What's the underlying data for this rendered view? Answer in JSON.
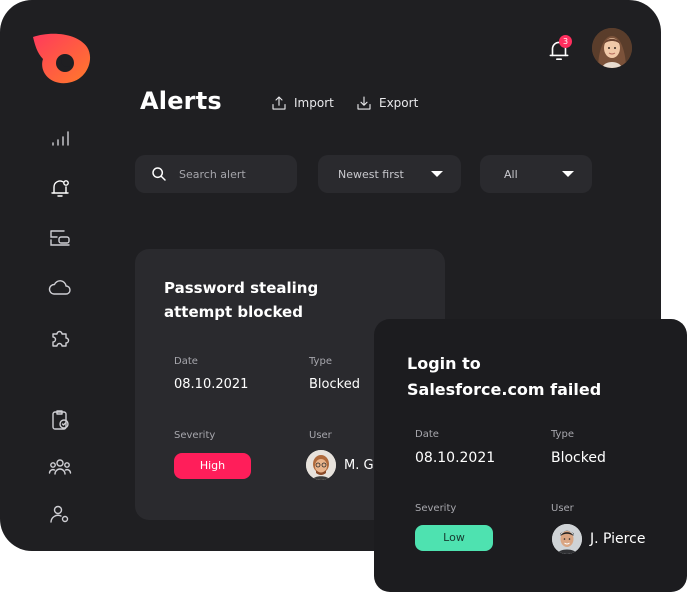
{
  "header": {
    "title": "Alerts",
    "import_label": "Import",
    "export_label": "Export",
    "notification_count": "3"
  },
  "filters": {
    "search_placeholder": "Search alert",
    "sort_selected": "Newest first",
    "type_selected": "All"
  },
  "sidebar": {
    "items": [
      "analytics-icon",
      "alerts-icon",
      "devices-icon",
      "cloud-icon",
      "extensions-icon",
      "tasks-icon",
      "team-icon",
      "user-settings-icon"
    ]
  },
  "alerts": [
    {
      "title_line1": "Password stealing",
      "title_line2": "attempt blocked",
      "date_label": "Date",
      "date": "08.10.2021",
      "type_label": "Type",
      "type": "Blocked",
      "severity_label": "Severity",
      "severity": "High",
      "user_label": "User",
      "user": "M. G"
    },
    {
      "title_line1": "Login to",
      "title_line2": "Salesforce.com failed",
      "date_label": "Date",
      "date": "08.10.2021",
      "type_label": "Type",
      "type": "Blocked",
      "severity_label": "Severity",
      "severity": "Low",
      "user_label": "User",
      "user": "J. Pierce"
    }
  ],
  "colors": {
    "accent": "#ff2e5e",
    "high": "#ff1e5a",
    "low": "#4ee2b0",
    "background": "#1f1f22"
  }
}
